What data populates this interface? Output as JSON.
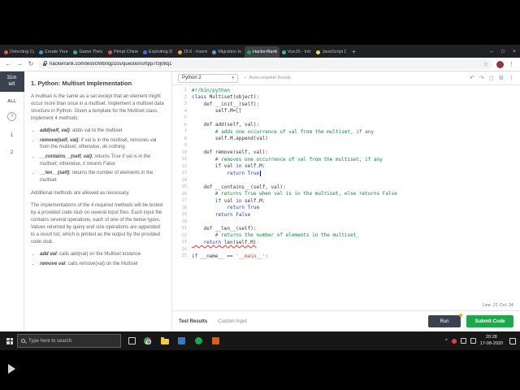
{
  "browser": {
    "tabs": [
      {
        "label": "Detecting Cy",
        "color": "#e05d44",
        "active": false
      },
      {
        "label": "Create Your",
        "color": "#4a90d9",
        "active": false
      },
      {
        "label": "Game Theo",
        "color": "#3aa89c",
        "active": false
      },
      {
        "label": "Pimpt Chine",
        "color": "#d9534f",
        "active": false
      },
      {
        "label": "Exploiting D",
        "color": "#4a6fd9",
        "active": false
      },
      {
        "label": "15.6 - Insert",
        "color": "#e8a33d",
        "active": false
      },
      {
        "label": "Migration to",
        "color": "#5b9bd5",
        "active": false
      },
      {
        "label": "HackerRank",
        "color": "#1ba94c",
        "active": true
      },
      {
        "label": "VueJS - Intr",
        "color": "#42b883",
        "active": false
      },
      {
        "label": "JavaScript D",
        "color": "#f0db4f",
        "active": false
      }
    ],
    "new_tab_glyph": "+",
    "window_controls": [
      {
        "glyph": "–",
        "name": "minimize-button"
      },
      {
        "glyph": "□",
        "name": "maximize-button"
      },
      {
        "glyph": "×",
        "name": "close-button"
      }
    ],
    "nav": {
      "back": "←",
      "forward": "→",
      "reload": "↻"
    },
    "url": "hackerrank.com/test/ch9b0qp1os/questions/hpp7f3j08q1",
    "star": "☆",
    "menu": "⋮"
  },
  "sidebar": {
    "timer_value": "31m",
    "timer_unit": "left",
    "all_label": "ALL",
    "help_glyph": "?",
    "questions": [
      "1",
      "2"
    ]
  },
  "question": {
    "title": "1. Python: Multiset Implementation",
    "para_intro": "A multiset is the same as a set except that an element might occur more than once in a multiset. Implement a multiset data structure in Python. Given a template for the Multiset class, implement 4 methods:",
    "method_bullets": [
      {
        "code": "add(self, val)",
        "text": ": adds val to the multiset"
      },
      {
        "code": "remove(self, val)",
        "text": ": if val is in the multiset, removes val from the multiset; otherwise, do nothing"
      },
      {
        "code": "__contains__(self, val)",
        "text": ": returns True if val is in the multiset; otherwise, it returns False"
      },
      {
        "code": "__len__(self)",
        "text": ": returns the number of elements in the multiset"
      }
    ],
    "para_additional": "Additional methods are allowed as necessary.",
    "para_testing": "The implementations of the 4 required methods will be tested by a provided code stub on several input files. Each input file contains several operations, each of one of the below types. Values returned by query and size operations are appended to a result list, which is printed as the output by the provided code stub.",
    "operation_bullets": [
      {
        "code": "add val",
        "text": ": calls add(val) on the Multiset instance"
      },
      {
        "code": "remove val",
        "text": ": calls remove(val) on the Multiset"
      }
    ]
  },
  "editor": {
    "language": "Python 2",
    "chevron": "▾",
    "autocomplete_check": "✓",
    "autocomplete_label": "Autocomplete Ready",
    "toolbar_icons": [
      {
        "glyph": "↶",
        "name": "undo-icon"
      },
      {
        "glyph": "↷",
        "name": "redo-icon"
      },
      {
        "glyph": "◻",
        "name": "fullscreen-icon"
      },
      {
        "glyph": "⚙",
        "name": "settings-icon"
      },
      {
        "glyph": "⋮",
        "name": "more-options-icon"
      }
    ],
    "status": "Line: 21 Col: 24",
    "lines": [
      {
        "n": 1,
        "text": "#!/bin/python"
      },
      {
        "n": 2,
        "text": "class Multiset(object):"
      },
      {
        "n": 3,
        "text": "    def __init__(self):"
      },
      {
        "n": 4,
        "text": "        self.M=[]"
      },
      {
        "n": 5,
        "text": ""
      },
      {
        "n": 6,
        "text": "    def add(self, val):"
      },
      {
        "n": 7,
        "text": "        # adds one occurrence of val from the multiset, if any"
      },
      {
        "n": 8,
        "text": "        self.M.append(val)"
      },
      {
        "n": 9,
        "text": ""
      },
      {
        "n": 10,
        "text": "    def remove(self, val):"
      },
      {
        "n": 11,
        "text": "        # removes one occurrence of val from the multiset, if any"
      },
      {
        "n": 12,
        "text": "        if val in self.M:"
      },
      {
        "n": 13,
        "text": "            return True",
        "cursor": true
      },
      {
        "n": 14,
        "text": ""
      },
      {
        "n": 15,
        "text": "    def __contains__(self, val):"
      },
      {
        "n": 16,
        "text": "        # returns True when val is in the multiset, else returns False"
      },
      {
        "n": 17,
        "text": "        if val in self.M:"
      },
      {
        "n": 18,
        "text": "            return True"
      },
      {
        "n": 19,
        "text": "        return False"
      },
      {
        "n": 20,
        "text": ""
      },
      {
        "n": 21,
        "text": "    def __len__(self):"
      },
      {
        "n": 22,
        "text": "        # returns the number of elements in the multiset_"
      },
      {
        "n": 23,
        "text": "    return len(self.M)",
        "err": true
      },
      {
        "n": 24,
        "text": ""
      },
      {
        "n": 25,
        "text": "if __name__ == '__main__':"
      }
    ]
  },
  "footer": {
    "tabs": [
      "Test Results",
      "Custom Input"
    ],
    "run_label": "Run",
    "submit_label": "Submit Code"
  },
  "taskbar": {
    "search_placeholder": "Type here to search",
    "apps": [
      "chrome",
      "file-explorer",
      "app-blue",
      "app-green",
      "app-orange"
    ],
    "tray_chevron": "^",
    "time": "20:28",
    "date": "17-08-2020"
  }
}
